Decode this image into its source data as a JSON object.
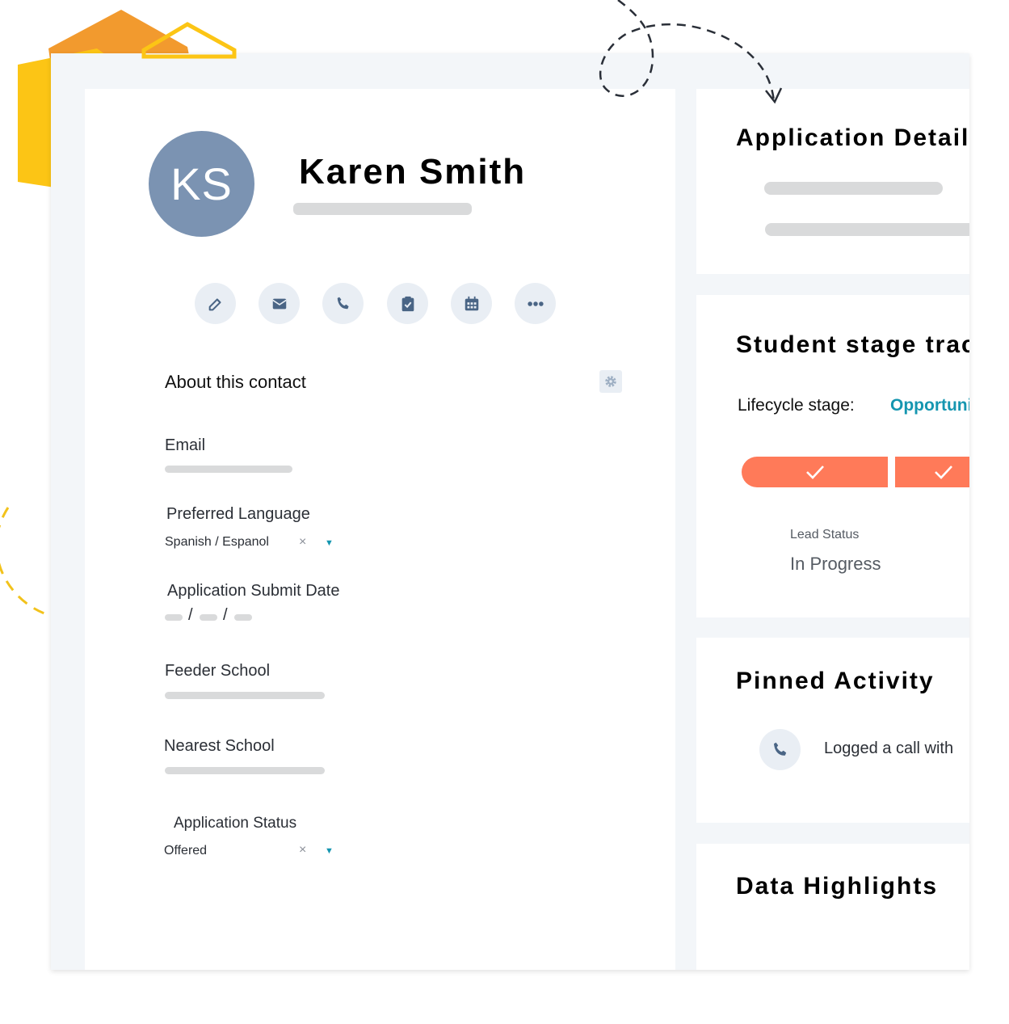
{
  "contact": {
    "initials": "KS",
    "name": "Karen Smith"
  },
  "actions": [
    {
      "icon": "edit-icon"
    },
    {
      "icon": "email-icon"
    },
    {
      "icon": "phone-icon"
    },
    {
      "icon": "task-icon"
    },
    {
      "icon": "calendar-icon"
    },
    {
      "icon": "more-icon"
    }
  ],
  "about": {
    "title": "About this contact",
    "settings_icon": "gear-icon",
    "email_label": "Email",
    "language_label": "Preferred Language",
    "language_value": "Spanish / Espanol",
    "submit_date_label": "Application Submit Date",
    "date_separator": "/",
    "feeder_label": "Feeder School",
    "nearest_label": "Nearest School",
    "status_label": "Application Status",
    "status_value": "Offered",
    "clear_symbol": "×",
    "dropdown_symbol": "▼"
  },
  "application_details": {
    "title": "Application Details"
  },
  "stage_tracker": {
    "title": "Student stage tracker",
    "lifecycle_label": "Lifecycle stage:",
    "lifecycle_value": "Opportunity",
    "accent_color": "#ff7a59",
    "lead_status_label": "Lead Status",
    "lead_status_value": "In Progress"
  },
  "pinned_activity": {
    "title": "Pinned Activity",
    "item_text": "Logged a call with",
    "icon": "phone-icon"
  },
  "data_highlights": {
    "title": "Data Highlights"
  },
  "colors": {
    "avatar": "#7b93b2",
    "link": "#1596b0",
    "stage_bar": "#ff7a59",
    "icon": "#4a6585"
  }
}
